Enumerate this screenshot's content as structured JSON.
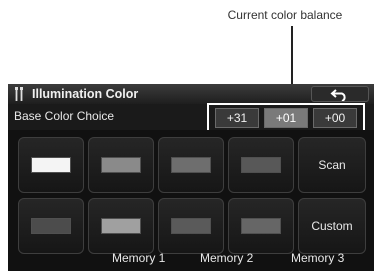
{
  "callout": {
    "text": "Current color balance"
  },
  "window": {
    "title": "Illumination Color",
    "title_icon": "illumination-icon",
    "back_icon": "back-arrow-icon"
  },
  "base_color": {
    "label": "Base Color Choice"
  },
  "color_balance": {
    "values": [
      "+31",
      "+01",
      "+00"
    ],
    "selected_index": 1
  },
  "swatches": {
    "row1": [
      "#f4f4f4",
      "#8a8a8a",
      "#6e6e6e",
      "#585858"
    ],
    "row2": [
      "#4c4c4c",
      "#a0a0a0",
      "#5a5a5a",
      "#666666"
    ],
    "selected": "row1.0"
  },
  "buttons": {
    "scan": "Scan",
    "custom": "Custom"
  },
  "memory_labels": [
    "Memory 1",
    "Memory 2",
    "Memory 3"
  ]
}
